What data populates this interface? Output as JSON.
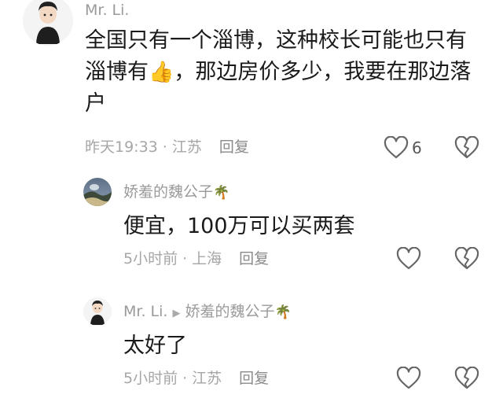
{
  "comments": [
    {
      "user": "Mr. Li.",
      "content": "全国只有一个淄博，这种校长可能也只有淄博有👍，那边房价多少，我要在那边落户",
      "content_line1": "全国只有一个淄博，这种校长可能也只有",
      "content_line2_prefix": "淄博有",
      "content_emoji": "👍",
      "content_line2_suffix": "，那边房价多少，我要在那边落",
      "content_line3": "户",
      "time": "昨天19:33",
      "location": "江苏",
      "reply_label": "回复",
      "like_count": "6",
      "icons": [
        "heart-outline-icon",
        "broken-heart-icon"
      ]
    },
    {
      "user": "娇羞的魏公子",
      "user_badge": "🌴",
      "content": "便宜，100万可以买两套",
      "time": "5小时前",
      "location": "上海",
      "reply_label": "回复",
      "icons": [
        "heart-outline-icon",
        "broken-heart-icon"
      ]
    },
    {
      "user": "Mr. Li.",
      "reply_to": "娇羞的魏公子",
      "reply_to_badge": "🌴",
      "content": "太好了",
      "time": "5小时前",
      "location": "江苏",
      "reply_label": "回复",
      "icons": [
        "heart-outline-icon",
        "broken-heart-icon"
      ]
    }
  ],
  "meta_separator": "·",
  "reply_arrow": "▶"
}
